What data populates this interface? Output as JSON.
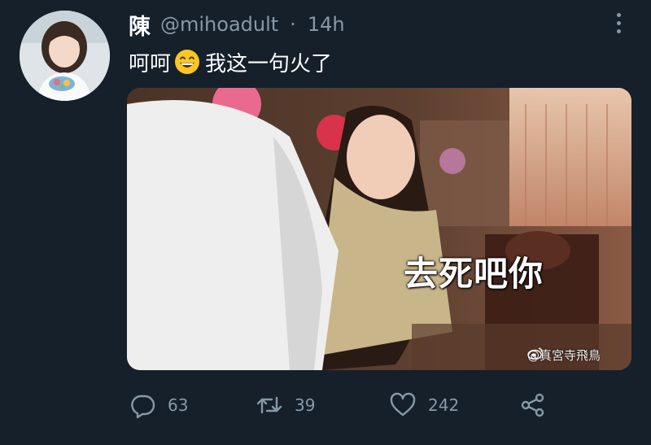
{
  "tweet": {
    "display_name": "陳",
    "handle": "@mihoadult",
    "separator": "·",
    "time": "14h",
    "text_before_emoji": "呵呵",
    "emoji": "grinning-face-emoji",
    "text_after_emoji": "我这一句火了"
  },
  "media": {
    "subtitle": "去死吧你",
    "watermark": "@真宮寺飛鳥"
  },
  "actions": {
    "reply_count": "63",
    "retweet_count": "39",
    "like_count": "242"
  },
  "icons": [
    "avatar",
    "more-icon",
    "reply-icon",
    "retweet-icon",
    "like-icon",
    "share-icon",
    "weibo-icon"
  ],
  "colors": {
    "background": "#15202b",
    "primary_text": "#ffffff",
    "secondary_text": "#8899a6"
  }
}
